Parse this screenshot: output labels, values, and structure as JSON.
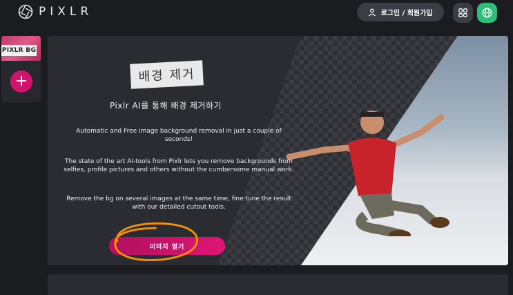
{
  "header": {
    "logo_text": "PIXLR",
    "login_label": "로그인 / 회원가입"
  },
  "sidebar": {
    "thumb_label": "PIXLR BG",
    "add_symbol": "+"
  },
  "hero": {
    "title": "배경 제거",
    "subtitle": "Pixlr AI를 통해 배경 제거하기",
    "paragraphs": [
      "Automatic and Free image background removal in just a couple of seconds!",
      "The state of the art AI-tools from Pixlr lets you remove backgrounds from selfies, profile pictures and others without the cumbersome manual work.",
      "Remove the bg on several images at the same time, fine tune the result with our detailed cutout tools."
    ],
    "cta_label": "이미지 열기"
  },
  "colors": {
    "accent": "#d1136e",
    "globe_bg": "#2dbe7a",
    "annotation": "#f39200"
  },
  "icons": [
    "pixlr-logo-icon",
    "user-icon",
    "apps-grid-icon",
    "globe-icon",
    "plus-icon"
  ]
}
